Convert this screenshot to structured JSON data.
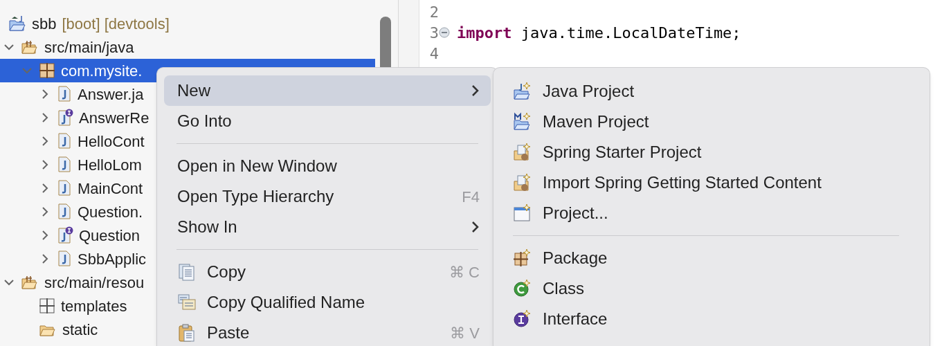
{
  "project_tree": {
    "items": [
      {
        "label": "sbb",
        "decoration": "[boot] [devtools]",
        "kind": "project",
        "selected": false
      },
      {
        "label": "src/main/java",
        "kind": "source-folder",
        "expanded": true,
        "selected": false,
        "children": [
          {
            "label": "com.mysite.",
            "kind": "package",
            "expanded": true,
            "selected": true,
            "children": [
              {
                "label": "Answer.ja",
                "kind": "class",
                "expanded": false,
                "selected": false
              },
              {
                "label": "AnswerRe",
                "kind": "interface",
                "expanded": false,
                "selected": false
              },
              {
                "label": "HelloCont",
                "kind": "class",
                "expanded": false,
                "selected": false
              },
              {
                "label": "HelloLom",
                "kind": "class",
                "expanded": false,
                "selected": false
              },
              {
                "label": "MainCont",
                "kind": "class",
                "expanded": false,
                "selected": false
              },
              {
                "label": "Question.",
                "kind": "class",
                "expanded": false,
                "selected": false
              },
              {
                "label": "Question",
                "kind": "interface",
                "expanded": false,
                "selected": false
              },
              {
                "label": "SbbApplic",
                "kind": "class",
                "expanded": false,
                "selected": false
              }
            ]
          }
        ]
      },
      {
        "label": "src/main/resou",
        "kind": "source-folder",
        "expanded": true,
        "selected": false,
        "children": [
          {
            "label": "templates",
            "kind": "plain-package",
            "selected": false
          },
          {
            "label": "static",
            "kind": "folder",
            "selected": false
          }
        ]
      }
    ]
  },
  "editor": {
    "lines": [
      {
        "number": "2"
      },
      {
        "number": "3",
        "folded": false,
        "tokens": [
          {
            "kind": "keyword",
            "text": "import"
          },
          {
            "kind": "plain",
            "text": " java.time.LocalDateTime;"
          }
        ]
      },
      {
        "number": "4"
      }
    ]
  },
  "context_menu": {
    "items": [
      {
        "kind": "item",
        "label": "New",
        "submenu": true,
        "selected": true
      },
      {
        "kind": "item",
        "label": "Go Into",
        "submenu": false,
        "selected": false
      },
      {
        "kind": "separator"
      },
      {
        "kind": "item",
        "label": "Open in New Window",
        "submenu": false,
        "selected": false
      },
      {
        "kind": "item",
        "label": "Open Type Hierarchy",
        "shortcut": "F4",
        "submenu": false,
        "selected": false
      },
      {
        "kind": "item",
        "label": "Show In",
        "submenu": true,
        "selected": false
      },
      {
        "kind": "separator"
      },
      {
        "kind": "icon-item",
        "label": "Copy",
        "shortcut": "⌘ C",
        "submenu": false,
        "selected": false
      },
      {
        "kind": "icon-item",
        "label": "Copy Qualified Name",
        "submenu": false,
        "selected": false
      },
      {
        "kind": "icon-item",
        "label": "Paste",
        "shortcut": "⌘ V",
        "submenu": false,
        "selected": false
      }
    ]
  },
  "submenu": {
    "items": [
      {
        "kind": "item",
        "label": "Java Project"
      },
      {
        "kind": "item",
        "label": "Maven Project"
      },
      {
        "kind": "item",
        "label": "Spring Starter Project"
      },
      {
        "kind": "item",
        "label": "Import Spring Getting Started Content"
      },
      {
        "kind": "item",
        "label": "Project..."
      },
      {
        "kind": "separator"
      },
      {
        "kind": "item",
        "label": "Package"
      },
      {
        "kind": "item",
        "label": "Class"
      },
      {
        "kind": "item",
        "label": "Interface"
      }
    ]
  }
}
